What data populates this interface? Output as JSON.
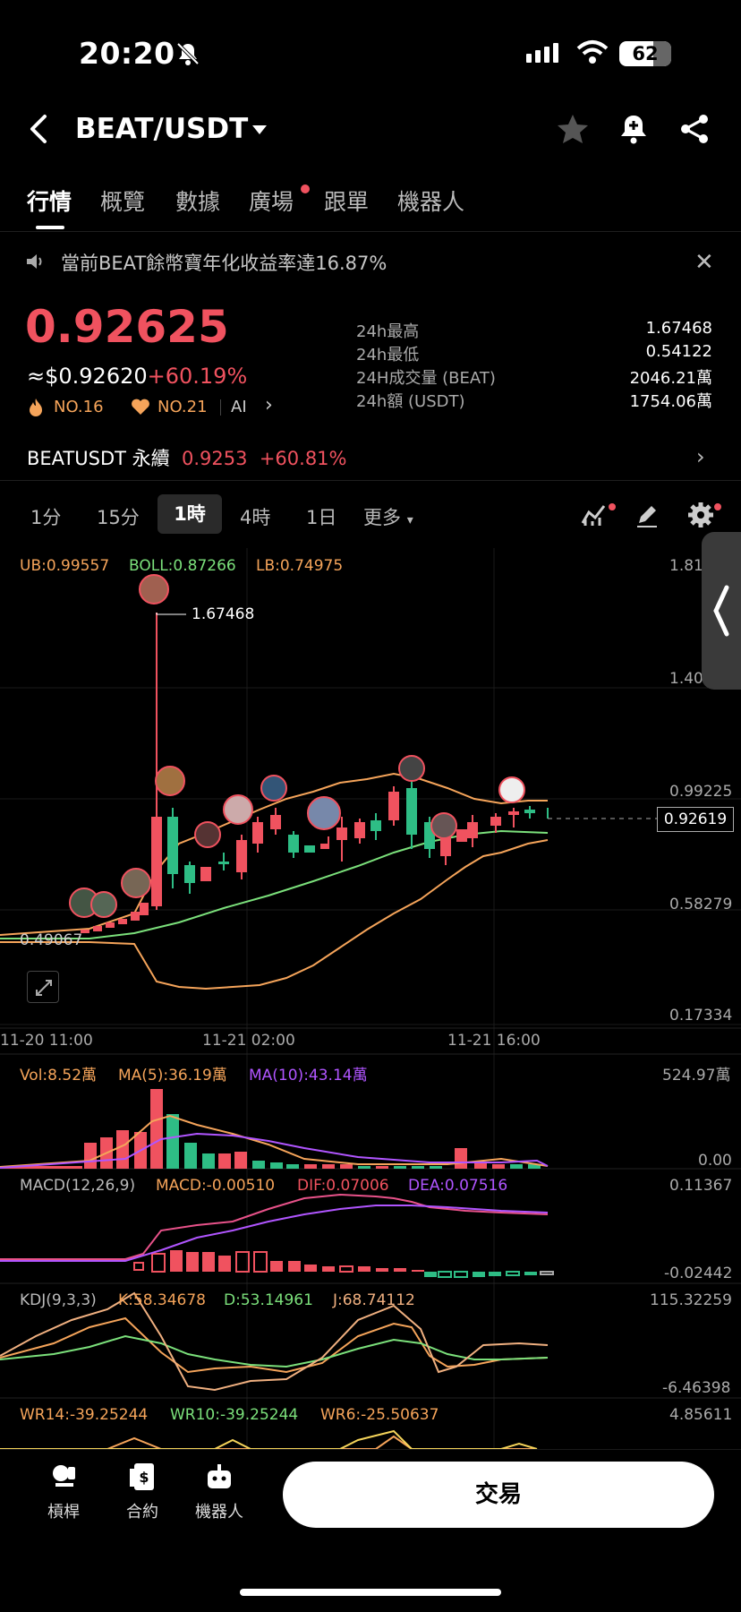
{
  "status_bar": {
    "time": "20:20",
    "battery": "62"
  },
  "header": {
    "pair": "BEAT/USDT"
  },
  "tabs": [
    {
      "label": "行情"
    },
    {
      "label": "概覽"
    },
    {
      "label": "數據"
    },
    {
      "label": "廣場"
    },
    {
      "label": "跟單"
    },
    {
      "label": "機器人"
    }
  ],
  "notice": {
    "text": "當前BEAT餘幣寶年化收益率達16.87%"
  },
  "ticker": {
    "price": "0.92625",
    "usd_price": "≈$0.92620",
    "change": "+60.19%",
    "rank_hot": "NO.16",
    "rank_fav": "NO.21",
    "ai": "AI"
  },
  "stats": [
    {
      "label": "24h最高",
      "value": "1.67468"
    },
    {
      "label": "24h最低",
      "value": "0.54122"
    },
    {
      "label": "24H成交量 (BEAT)",
      "value": "2046.21萬"
    },
    {
      "label": "24h額 (USDT)",
      "value": "1754.06萬"
    }
  ],
  "perpetual": {
    "name": "BEATUSDT 永續",
    "price": "0.9253",
    "change": "+60.81%"
  },
  "timeframes": [
    {
      "label": "1分"
    },
    {
      "label": "15分"
    },
    {
      "label": "1時"
    },
    {
      "label": "4時"
    },
    {
      "label": "1日"
    },
    {
      "label": "更多"
    }
  ],
  "boll": {
    "ub": "UB:0.99557",
    "boll": "BOLL:0.87266",
    "lb": "LB:0.74975"
  },
  "price_axis": [
    "1.81",
    "1.40",
    "0.99225",
    "0.58279",
    "0.17334"
  ],
  "time_axis": [
    "11-20 11:00",
    "11-21 02:00",
    "11-21 16:00"
  ],
  "high_marker": "1.67468",
  "low_marker": "0.49067",
  "current_price_tag": "0.92619",
  "volume": {
    "vol": "Vol:8.52萬",
    "ma5": "MA(5):36.19萬",
    "ma10": "MA(10):43.14萬",
    "max": "524.97萬",
    "min": "0.00"
  },
  "macd": {
    "title": "MACD(12,26,9)",
    "macd": "MACD:-0.00510",
    "dif": "DIF:0.07006",
    "dea": "DEA:0.07516",
    "max": "0.11367",
    "min": "-0.02442"
  },
  "kdj": {
    "title": "KDJ(9,3,3)",
    "k": "K:58.34678",
    "d": "D:53.14961",
    "j": "J:68.74112",
    "max": "115.32259",
    "min": "-6.46398"
  },
  "wr": {
    "wr14": "WR14:-39.25244",
    "wr10": "WR10:-39.25244",
    "wr6": "WR6:-25.50637",
    "max": "4.85611"
  },
  "bottom_nav": [
    {
      "label": "槓桿"
    },
    {
      "label": "合約"
    },
    {
      "label": "機器人"
    }
  ],
  "trade_button": "交易",
  "colors": {
    "up": "#f0525f",
    "down": "#2ebd85",
    "accent_orange": "#f5a45a"
  }
}
